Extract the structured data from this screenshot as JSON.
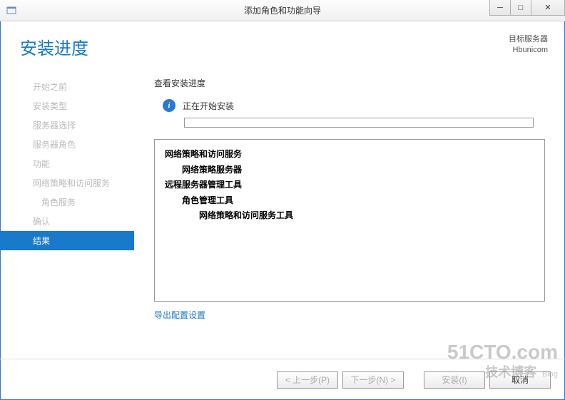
{
  "window": {
    "title": "添加角色和功能向导"
  },
  "header": {
    "page_title": "安装进度",
    "dest_label": "目标服务器",
    "dest_server": "Hbunicom"
  },
  "sidebar": {
    "items": [
      {
        "label": "开始之前"
      },
      {
        "label": "安装类型"
      },
      {
        "label": "服务器选择"
      },
      {
        "label": "服务器角色"
      },
      {
        "label": "功能"
      },
      {
        "label": "网络策略和访问服务"
      },
      {
        "label": "角色服务"
      },
      {
        "label": "确认"
      },
      {
        "label": "结果"
      }
    ]
  },
  "main": {
    "section_label": "查看安装进度",
    "status_text": "正在开始安装",
    "features": {
      "g1": "网络策略和访问服务",
      "g1_1": "网络策略服务器",
      "g2": "远程服务器管理工具",
      "g2_1": "角色管理工具",
      "g2_1_1": "网络策略和访问服务工具"
    },
    "export_link": "导出配置设置"
  },
  "footer": {
    "prev": "< 上一步(P)",
    "next": "下一步(N) >",
    "install": "安装(I)",
    "cancel": "取消"
  },
  "watermark": {
    "line1": "51CTO.com",
    "line2": "技术博客",
    "blog": "Blog"
  }
}
